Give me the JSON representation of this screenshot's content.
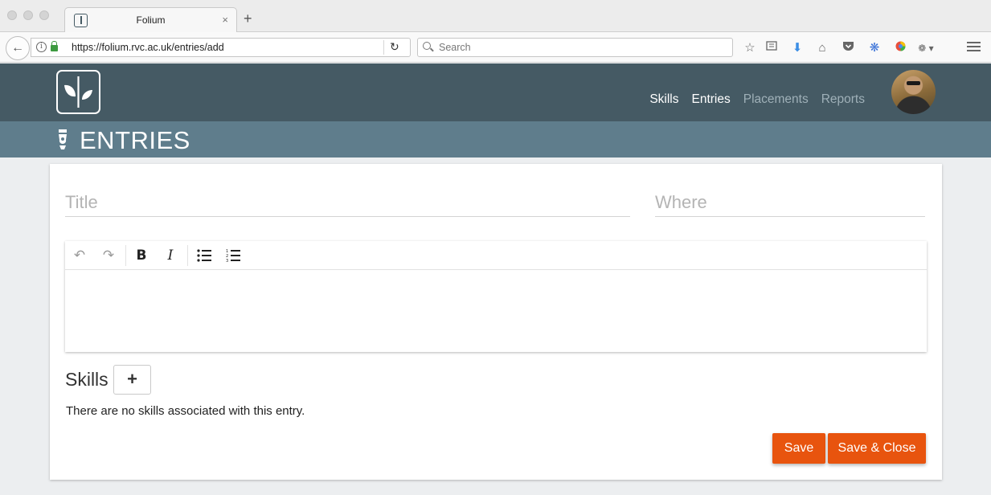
{
  "browser": {
    "tab_title": "Folium",
    "tab_close": "×",
    "new_tab": "+",
    "url": "https://folium.rvc.ac.uk/entries/add",
    "search_placeholder": "Search",
    "toolbar_icons": [
      "bookmark-star-icon",
      "reading-list-icon",
      "download-icon",
      "home-icon",
      "pocket-icon",
      "extension-icon",
      "color-wheel-icon",
      "extension-bird-icon"
    ]
  },
  "app": {
    "nav": [
      {
        "label": "Skills",
        "active": true
      },
      {
        "label": "Entries",
        "active": true
      },
      {
        "label": "Placements",
        "active": false
      },
      {
        "label": "Reports",
        "active": false
      }
    ],
    "page_title": "ENTRIES",
    "colors": {
      "header": "#455a64",
      "banner": "#5f7d8c",
      "accent": "#e8540e"
    }
  },
  "form": {
    "title_placeholder": "Title",
    "where_placeholder": "Where",
    "editor_tools": [
      "undo-icon",
      "redo-icon",
      "bold-icon",
      "italic-icon",
      "bulleted-list-icon",
      "numbered-list-icon"
    ],
    "skills_heading": "Skills",
    "add_skill_label": "+",
    "no_skills_text": "There are no skills associated with this entry.",
    "save_label": "Save",
    "save_close_label": "Save & Close"
  }
}
